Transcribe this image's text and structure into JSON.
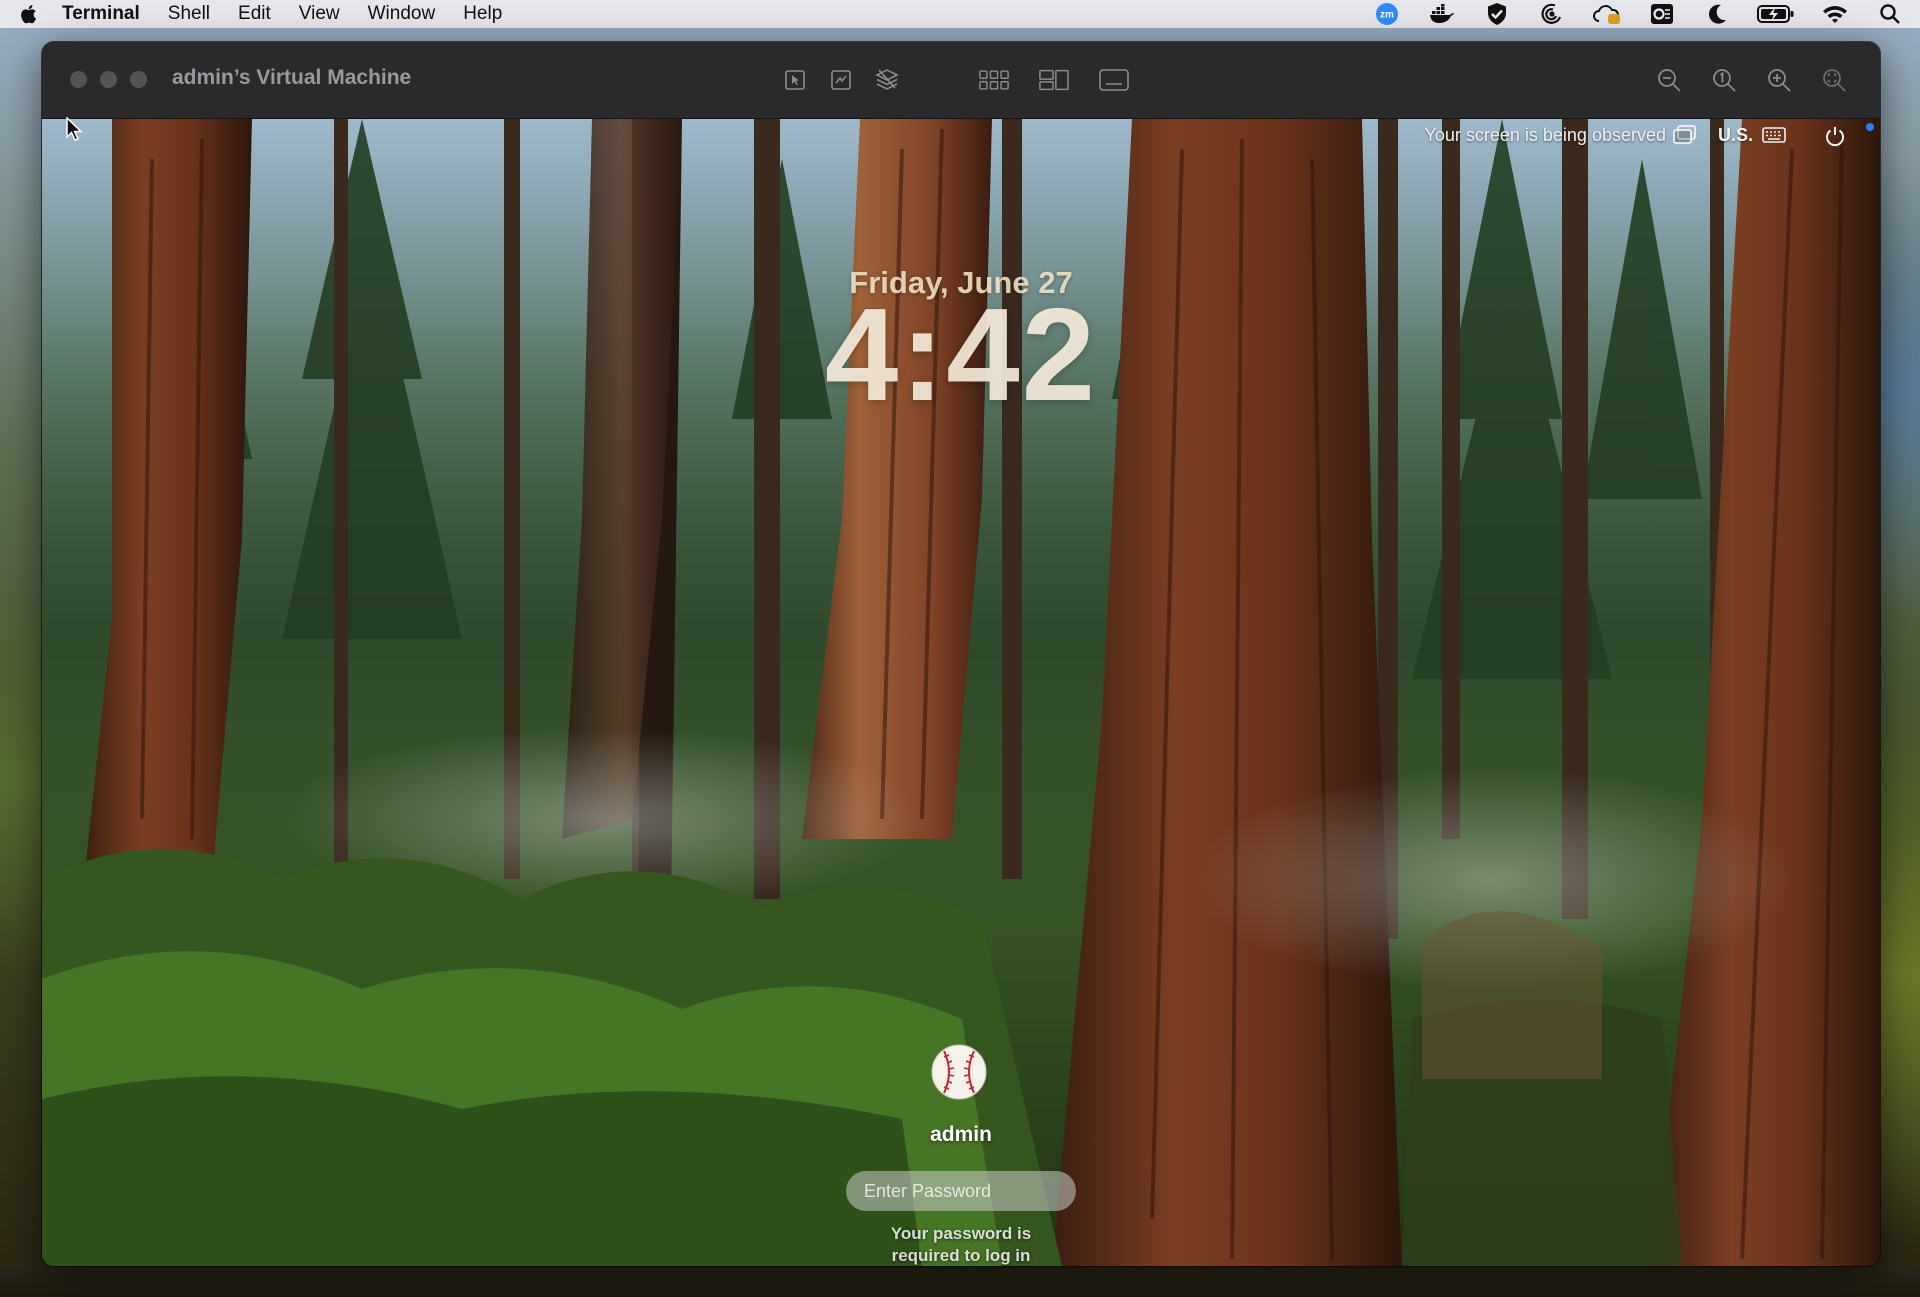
{
  "menubar": {
    "app_name": "Terminal",
    "items": [
      "Shell",
      "Edit",
      "View",
      "Window",
      "Help"
    ],
    "status_icons": [
      "zoom-icon",
      "docker-icon",
      "shield-icon",
      "focus-swirl-icon",
      "cloud-sync-icon",
      "outlook-icon",
      "moon-icon",
      "battery-charging-icon",
      "wifi-icon",
      "search-icon"
    ],
    "zoom_badge": "zm"
  },
  "window": {
    "title": "admin’s Virtual Machine",
    "toolbar_icons": [
      "pointer-icon",
      "capture-icon",
      "layers-icon",
      "grid-view-icon",
      "split-view-icon",
      "display-icon"
    ],
    "zoom_icons": [
      "zoom-out-icon",
      "zoom-actual-icon",
      "zoom-in-icon",
      "zoom-fit-icon"
    ]
  },
  "lockscreen": {
    "observed_text": "Your screen is being observed",
    "input_source": "U.S.",
    "date": "Friday, June 27",
    "time": "4:42",
    "username": "admin",
    "password_placeholder": "Enter Password",
    "password_value": "",
    "hint": "Your password is required to log in"
  },
  "colors": {
    "menubar_bg": "#ECECEE",
    "titlebar_bg": "#2A2A2C",
    "indicator_blue": "#2F7CF6",
    "zoom_blue": "#2D8CFF"
  }
}
